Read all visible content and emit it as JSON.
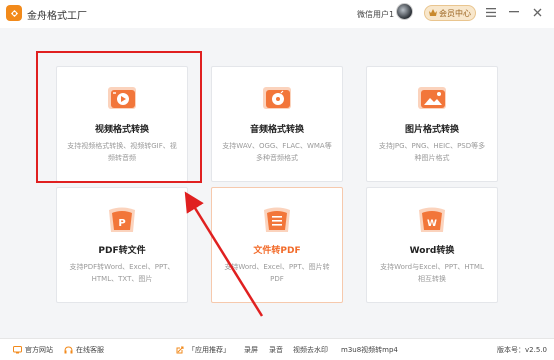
{
  "window": {
    "title": "金舟格式工厂",
    "username": "微信用户1",
    "vip_label": "会员中心",
    "controls": [
      "≡",
      "—",
      "✕"
    ]
  },
  "cards": [
    {
      "title": "视频格式转换",
      "desc": "支持视频格式转换、视频转GIF、视频转音频",
      "icon": "video-convert-icon"
    },
    {
      "title": "音频格式转换",
      "desc": "支持WAV、OGG、FLAC、WMA等多种音频格式",
      "icon": "audio-convert-icon"
    },
    {
      "title": "图片格式转换",
      "desc": "支持JPG、PNG、HEIC、PSD等多种图片格式",
      "icon": "image-convert-icon"
    },
    {
      "title": "PDF转文件",
      "desc": "支持PDF转Word、Excel、PPT、HTML、TXT、图片",
      "icon": "pdf-to-file-icon"
    },
    {
      "title": "文件转PDF",
      "desc": "支持Word、Excel、PPT、图片转PDF",
      "icon": "file-to-pdf-icon"
    },
    {
      "title": "Word转换",
      "desc": "支持Word与Excel、PPT、HTML相互转换",
      "icon": "word-convert-icon"
    }
  ],
  "statusbar": {
    "website": "官方网站",
    "support": "在线客服",
    "recommend": "「应用推荐」",
    "links": [
      "录屏",
      "录音",
      "视频去水印",
      "m3u8视频转mp4"
    ],
    "version": "版本号：v2.5.0"
  },
  "colors": {
    "accent": "#f26b2a",
    "highlight": "#e02020"
  }
}
